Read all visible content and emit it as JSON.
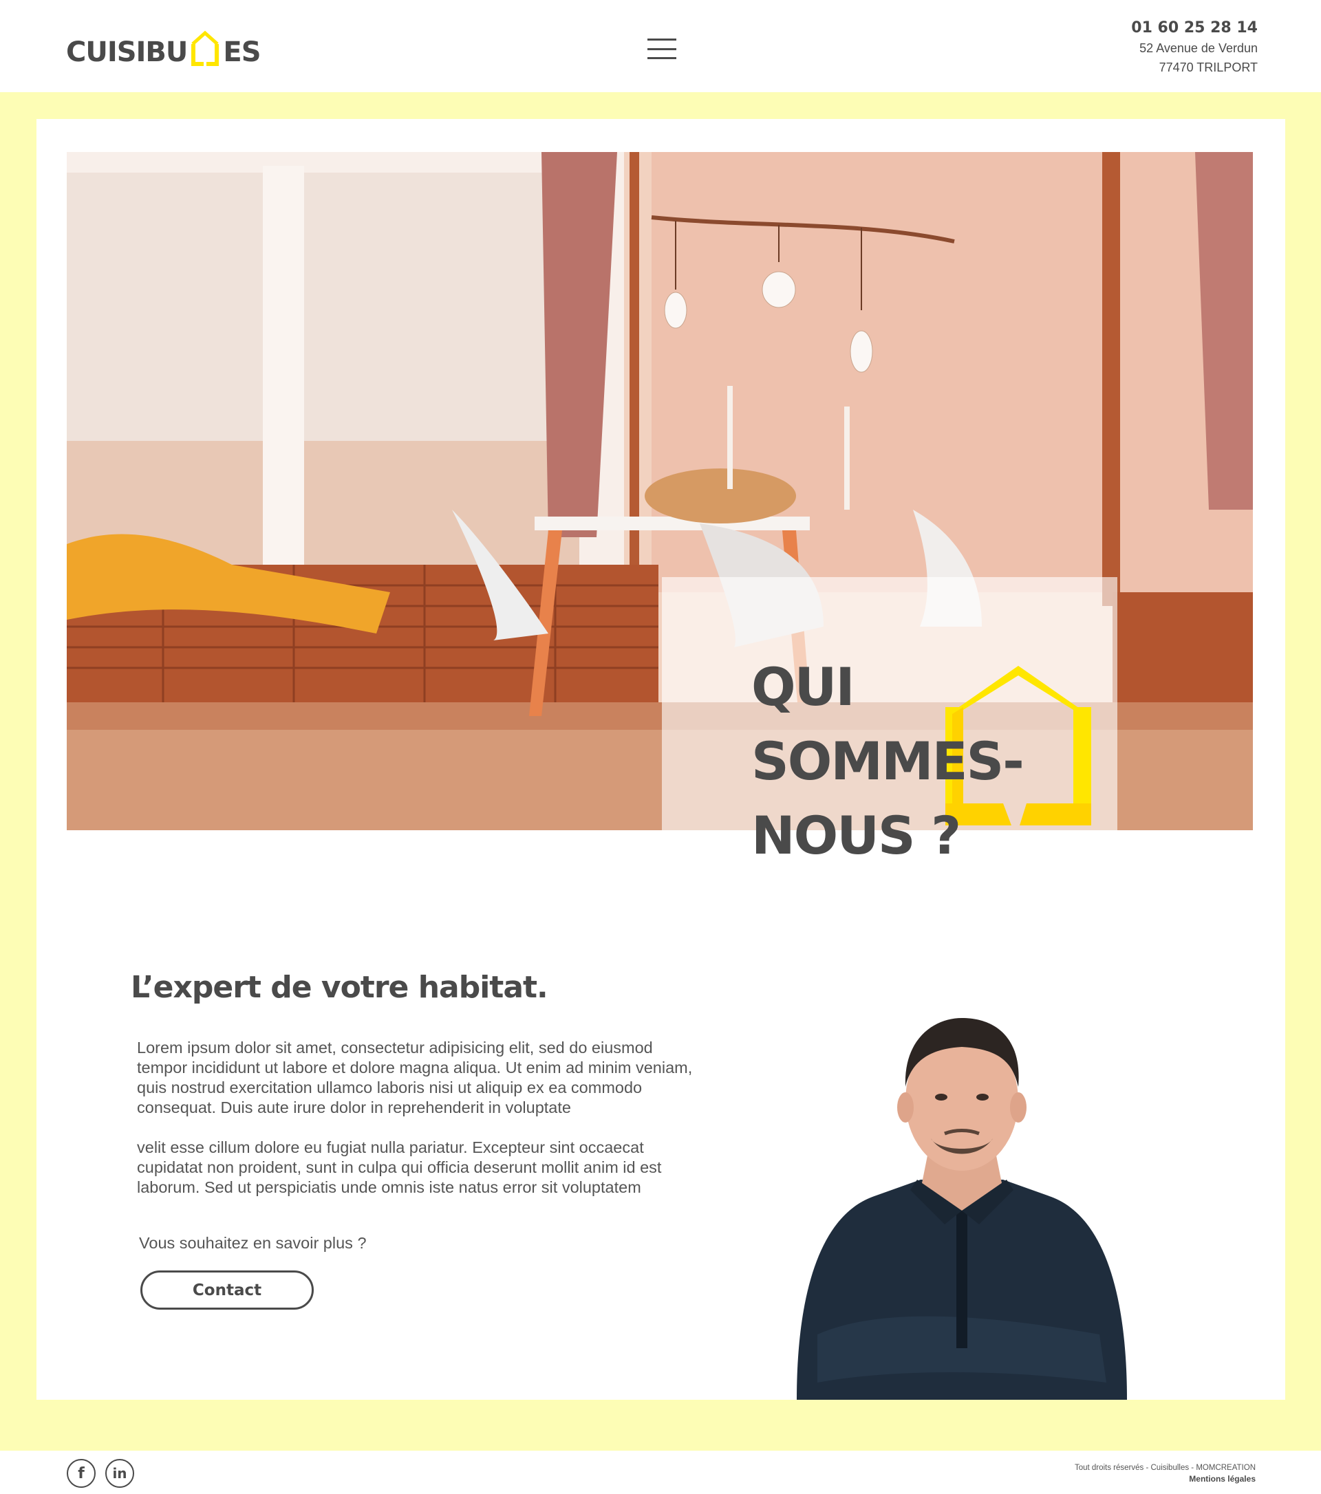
{
  "header": {
    "logo_text_left": "CUISIBU",
    "logo_text_right": "ES",
    "phone": "01 60 25 28 14",
    "address_line1": "52 Avenue de Verdun",
    "address_line2": "77470 TRILPORT",
    "menu_icon": "hamburger-icon"
  },
  "hero": {
    "title_line1": "QUI",
    "title_line2": "SOMMES-",
    "title_line3": "NOUS ?"
  },
  "about": {
    "headline": "L’expert de votre habitat.",
    "paragraph1": "Lorem ipsum dolor sit amet, consectetur adipisicing elit, sed do eiusmod tempor incididunt ut labore et dolore magna aliqua. Ut enim ad minim veniam, quis nostrud exercitation ullamco laboris nisi ut aliquip ex ea commodo consequat. Duis aute irure dolor in reprehenderit in voluptate",
    "paragraph2": "velit esse cillum dolore eu fugiat nulla pariatur. Excepteur sint occaecat cupidatat non proident, sunt in culpa qui officia deserunt mollit anim id est laborum. Sed ut perspiciatis unde omnis iste natus error sit voluptatem",
    "question": "Vous souhaitez en savoir plus ?",
    "contact_label": "Contact"
  },
  "footer": {
    "facebook_glyph": "f",
    "linkedin_glyph": "in",
    "rights": "Tout droits réservés - Cuisibulles - MOMCREATION",
    "legal": "Mentions légales"
  },
  "colors": {
    "accent_yellow": "#ffe600",
    "frame_yellow": "#fdfdb5",
    "text_dark": "#4a4a4a"
  }
}
